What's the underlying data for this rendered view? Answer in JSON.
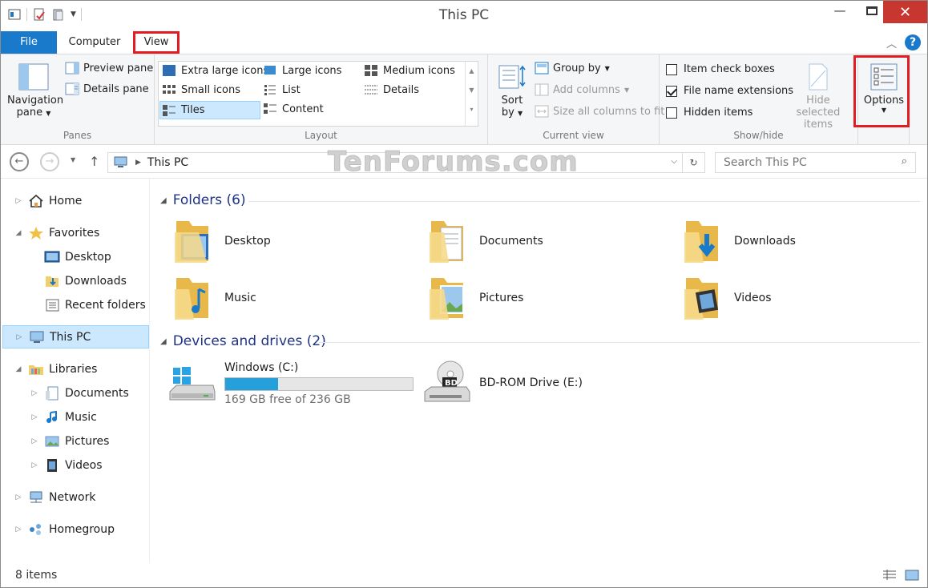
{
  "window": {
    "title": "This PC"
  },
  "ribbon_tabs": [
    {
      "label": "File"
    },
    {
      "label": "Computer"
    },
    {
      "label": "View"
    }
  ],
  "panes_group": {
    "navigation_pane": "Navigation",
    "navigation_pane_2": "pane",
    "preview_pane": "Preview pane",
    "details_pane": "Details pane",
    "label": "Panes"
  },
  "layout_group": {
    "items": [
      "Extra large icons",
      "Large icons",
      "Medium icons",
      "Small icons",
      "List",
      "Details",
      "Tiles",
      "Content"
    ],
    "selected": "Tiles",
    "label": "Layout"
  },
  "current_view_group": {
    "sort": "Sort",
    "sort_2": "by",
    "group_by": "Group by",
    "add_columns": "Add columns",
    "size_columns": "Size all columns to fit",
    "label": "Current view"
  },
  "showhide_group": {
    "item_check_boxes": "Item check boxes",
    "file_name_extensions": "File name extensions",
    "hidden_items": "Hidden items",
    "checked": {
      "item_check_boxes": false,
      "file_name_extensions": true,
      "hidden_items": false
    },
    "hide_selected": "Hide selected",
    "hide_selected_2": "items",
    "label": "Show/hide"
  },
  "options": {
    "label": "Options"
  },
  "address": {
    "path": "This PC",
    "search_placeholder": "Search This PC"
  },
  "watermark": "TenForums.com",
  "nav": {
    "home": "Home",
    "favorites": "Favorites",
    "fav_desktop": "Desktop",
    "fav_downloads": "Downloads",
    "fav_recent": "Recent folders",
    "this_pc": "This PC",
    "libraries": "Libraries",
    "lib_documents": "Documents",
    "lib_music": "Music",
    "lib_pictures": "Pictures",
    "lib_videos": "Videos",
    "network": "Network",
    "homegroup": "Homegroup"
  },
  "folders": {
    "header": "Folders (6)",
    "items": [
      "Desktop",
      "Documents",
      "Downloads",
      "Music",
      "Pictures",
      "Videos"
    ]
  },
  "drives": {
    "header": "Devices and drives (2)",
    "c_name": "Windows (C:)",
    "c_free": "169 GB free of 236 GB",
    "c_used_fraction": 0.284,
    "e_name": "BD-ROM Drive (E:)"
  },
  "status": {
    "items": "8 items"
  },
  "colors": {
    "accent": "#1979ca",
    "highlight": "#e31b23",
    "selection": "#cce8ff"
  }
}
